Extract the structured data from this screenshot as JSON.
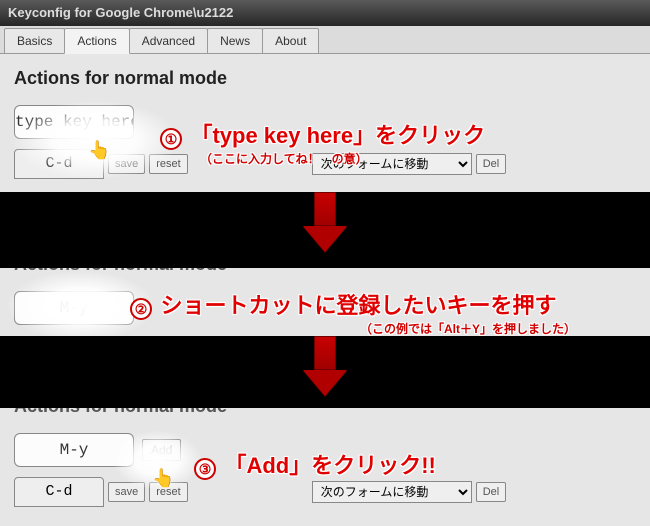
{
  "window": {
    "title": "Keyconfig for Google Chrome\\u2122"
  },
  "tabs": {
    "basics": "Basics",
    "actions": "Actions",
    "advanced": "Advanced",
    "news": "News",
    "about": "About"
  },
  "section": {
    "heading": "Actions for normal mode"
  },
  "keyinput": {
    "step1_value": "type key here",
    "step2_value": "M-y",
    "step3_value": "M-y",
    "add_label": "Add"
  },
  "binding": {
    "key": "C-d",
    "save": "save",
    "reset": "reset",
    "action": "次のフォームに移動",
    "del": "Del"
  },
  "annot": {
    "n1": "①",
    "n2": "②",
    "n3": "③",
    "step1_main": "「type key here」をクリック",
    "step1_sub": "（ここに入力してね！　の意）",
    "step2_main": "ショートカットに登録したいキーを押す",
    "step2_sub": "（この例では「Alt＋Y」を押しました）",
    "step3_main": "「Add」をクリック!!"
  },
  "cursor": "👆"
}
